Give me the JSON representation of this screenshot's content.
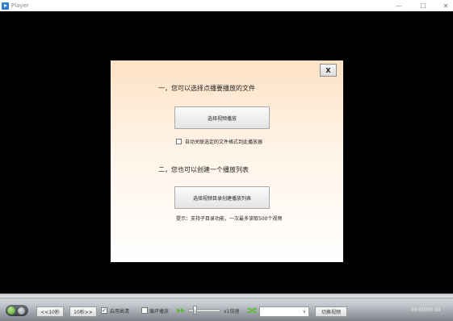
{
  "window": {
    "title": "Player",
    "minimize_glyph": "—",
    "maximize_glyph": "☐",
    "close_glyph": "✕"
  },
  "dialog": {
    "close_label": "X",
    "section1_title": "一，您可以选择点播要播放的文件",
    "select_video_button": "选择视频播放",
    "associate_checkbox_label": "自动关联选定的文件格式到此播放器",
    "associate_checked": false,
    "section2_title": "二，您也可以创建一个播放列表",
    "select_dir_button": "选择视频目录创建播放列表",
    "tip": "提示：支持子目录功能，一次最多读取500个视频"
  },
  "controls": {
    "back_button": "<<10秒",
    "forward_button": "10秒>>",
    "hd_label": "启用高清",
    "hd_checked": true,
    "hd_check_glyph": "✓",
    "loop_label": "循环播放",
    "loop_checked": false,
    "speed_label": "x1倍速",
    "speed_value": 1,
    "playlist_value": "",
    "select_arrow": "∨",
    "switch_button": "切换视频",
    "time": "00:00/00:00"
  },
  "colors": {
    "accent_green": "#5cb832",
    "title_icon": "#2f7fd1",
    "background": "#000000"
  },
  "icons": {
    "app": "player-icon",
    "play": "play-toggle-icon",
    "speed": "speed-arrow-icon",
    "shuffle": "shuffle-icon"
  }
}
